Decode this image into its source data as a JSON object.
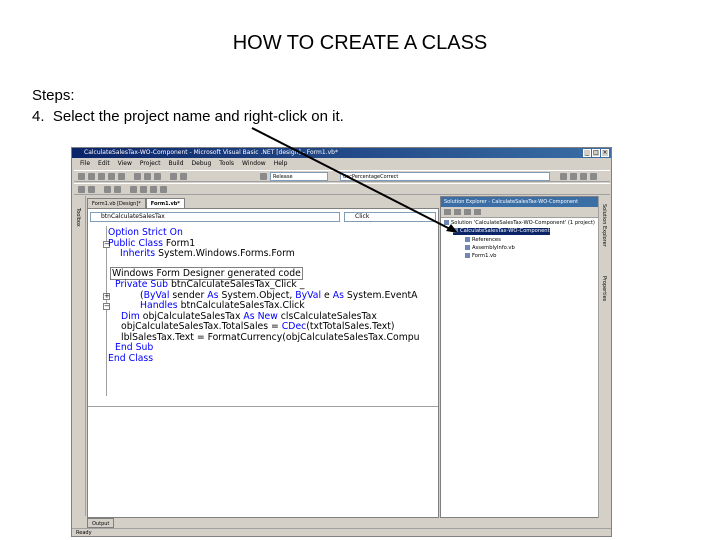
{
  "slide": {
    "title": "HOW TO CREATE A CLASS",
    "steps_heading": "Steps:",
    "step_text": "4.  Select the project name and right-click on it."
  },
  "ide": {
    "window_title": "CalculateSalesTax-WO-Component - Microsoft Visual Basic .NET [design] - Form1.vb*",
    "menu": [
      "File",
      "Edit",
      "View",
      "Project",
      "Build",
      "Debug",
      "Tools",
      "Window",
      "Help"
    ],
    "config_combo": "Release",
    "find_combo": "decPercentageCorrect",
    "toolbox_label": "Toolbox",
    "tabs": [
      "Form1.vb [Design]*",
      "Form1.vb*"
    ],
    "class_combo": "btnCalculateSalesTax",
    "method_combo": "Click",
    "output_tab": "Output",
    "status": "Ready",
    "right_strip": [
      "Solution Explorer",
      "Properties"
    ]
  },
  "code": {
    "l1_kw": "Option Strict On",
    "l2_kw": "Public Class",
    "l2_txt": " Form1",
    "l3_kw": "Inherits",
    "l3_txt": " System.Windows.Forms.Form",
    "l4_region": "Windows Form Designer generated code",
    "l5_kw": "Private Sub",
    "l5_txt": " btnCalculateSalesTax_Click _",
    "l6_a": "(",
    "l6_kw1": "ByVal",
    "l6_b": " sender ",
    "l6_kw2": "As",
    "l6_c": " System.Object, ",
    "l6_kw3": "ByVal",
    "l6_d": " e ",
    "l6_kw4": "As",
    "l6_e": " System.EventA",
    "l7_kw": "Handles",
    "l7_txt": " btnCalculateSalesTax.Click",
    "l8_kw1": "Dim",
    "l8_a": " objCalculateSalesTax ",
    "l8_kw2": "As New",
    "l8_b": " clsCalculateSalesTax",
    "l9_a": "objCalculateSalesTax.TotalSales = ",
    "l9_kw": "CDec",
    "l9_b": "(txtTotalSales.Text)",
    "l10_txt": "lblSalesTax.Text = FormatCurrency(objCalculateSalesTax.Compu",
    "l11_kw": "End Sub",
    "l12_kw": "End Class"
  },
  "solution_explorer": {
    "header": "Solution Explorer - CalculateSalesTax-WO-Component",
    "solution": "Solution 'CalculateSalesTax-WO-Component' (1 project)",
    "project": "CalculateSalesTax-WO-Component",
    "items": [
      "References",
      "AssemblyInfo.vb",
      "Form1.vb"
    ]
  }
}
